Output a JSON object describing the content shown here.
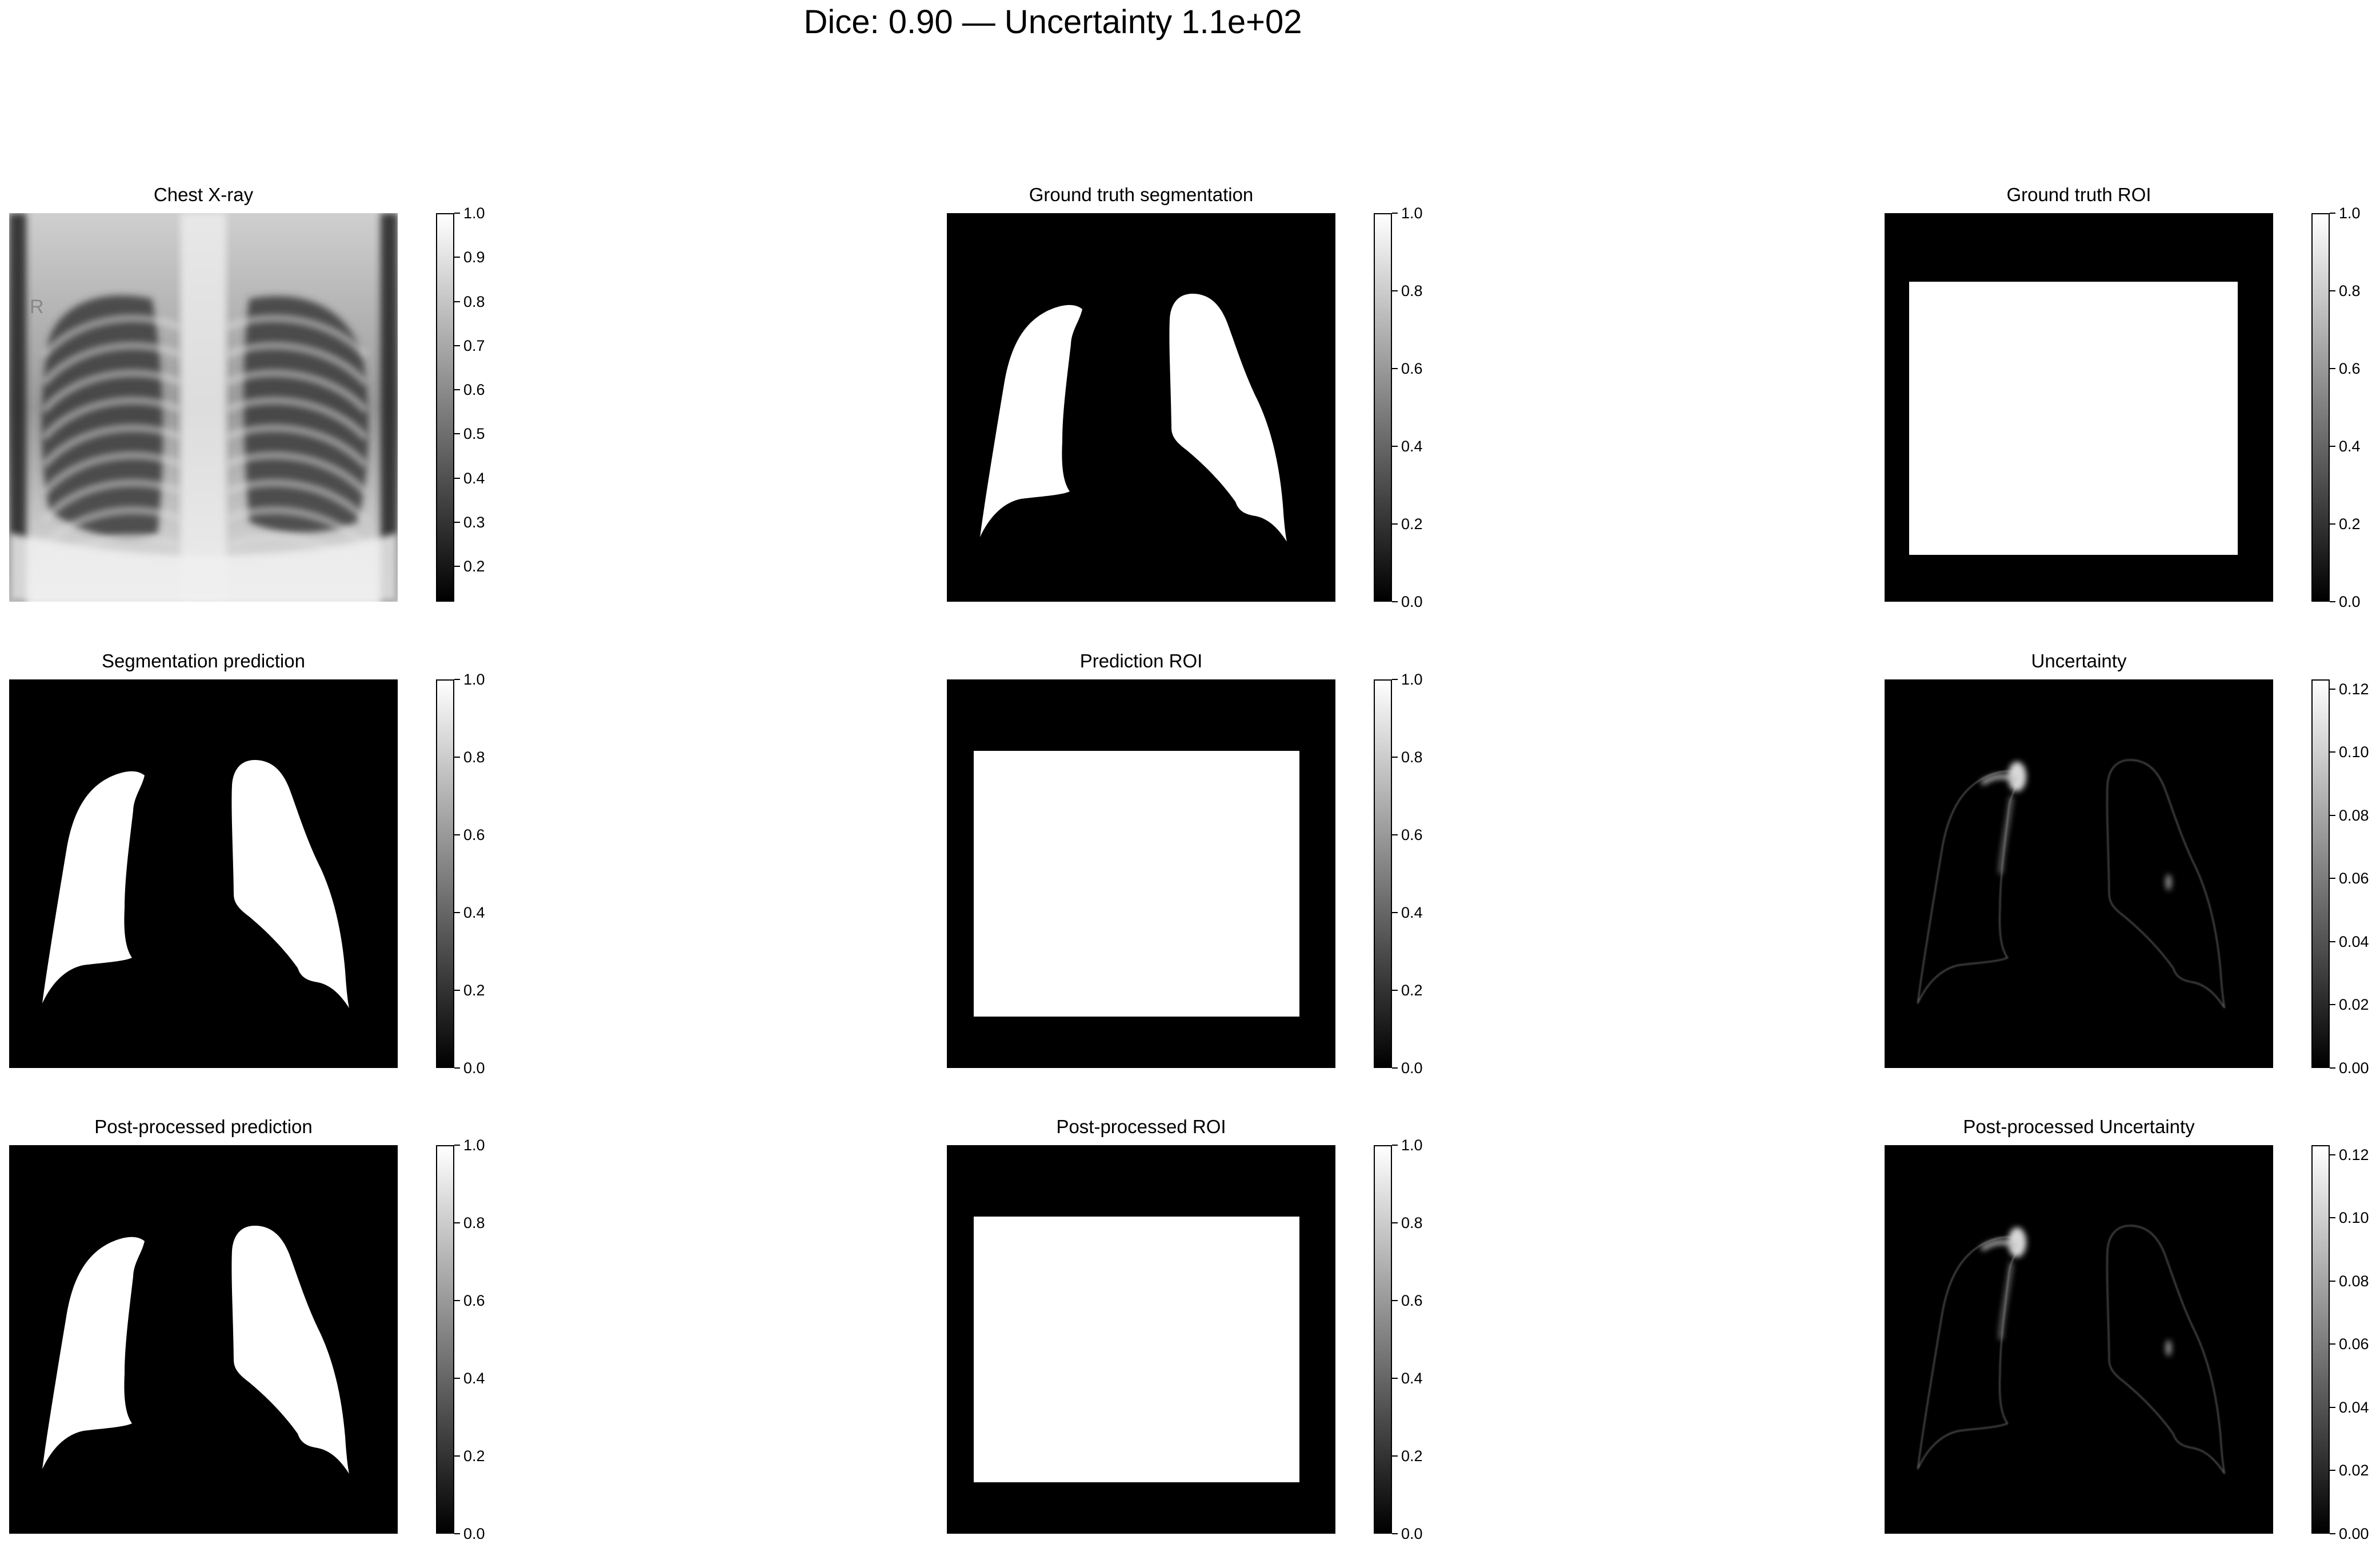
{
  "suptitle": "Dice: 0.90 — Uncertainty 1.1e+02",
  "panels": [
    {
      "title": "Chest X-ray",
      "kind": "xray",
      "colorbar": {
        "ticks": [
          "1.0",
          "0.9",
          "0.8",
          "0.7",
          "0.6",
          "0.5",
          "0.4",
          "0.3",
          "0.2"
        ],
        "vmin": 0.12,
        "vmax": 1.0
      }
    },
    {
      "title": "Ground truth segmentation",
      "kind": "mask-gt",
      "colorbar": {
        "ticks": [
          "1.0",
          "0.8",
          "0.6",
          "0.4",
          "0.2",
          "0.0"
        ],
        "vmin": 0.0,
        "vmax": 1.0
      }
    },
    {
      "title": "Ground truth ROI",
      "kind": "roi-gt",
      "colorbar": {
        "ticks": [
          "1.0",
          "0.8",
          "0.6",
          "0.4",
          "0.2",
          "0.0"
        ],
        "vmin": 0.0,
        "vmax": 1.0
      }
    },
    {
      "title": "Segmentation prediction",
      "kind": "mask-pred",
      "colorbar": {
        "ticks": [
          "1.0",
          "0.8",
          "0.6",
          "0.4",
          "0.2",
          "0.0"
        ],
        "vmin": 0.0,
        "vmax": 1.0
      }
    },
    {
      "title": "Prediction ROI",
      "kind": "roi-pred",
      "colorbar": {
        "ticks": [
          "1.0",
          "0.8",
          "0.6",
          "0.4",
          "0.2",
          "0.0"
        ],
        "vmin": 0.0,
        "vmax": 1.0
      }
    },
    {
      "title": "Uncertainty",
      "kind": "uncertainty",
      "colorbar": {
        "ticks": [
          "0.12",
          "0.10",
          "0.08",
          "0.06",
          "0.04",
          "0.02",
          "0.00"
        ],
        "vmin": 0.0,
        "vmax": 0.123
      }
    },
    {
      "title": "Post-processed prediction",
      "kind": "mask-pred",
      "colorbar": {
        "ticks": [
          "1.0",
          "0.8",
          "0.6",
          "0.4",
          "0.2",
          "0.0"
        ],
        "vmin": 0.0,
        "vmax": 1.0
      }
    },
    {
      "title": "Post-processed ROI",
      "kind": "roi-pred",
      "colorbar": {
        "ticks": [
          "1.0",
          "0.8",
          "0.6",
          "0.4",
          "0.2",
          "0.0"
        ],
        "vmin": 0.0,
        "vmax": 1.0
      }
    },
    {
      "title": "Post-processed Uncertainty",
      "kind": "uncertainty",
      "colorbar": {
        "ticks": [
          "0.12",
          "0.10",
          "0.08",
          "0.06",
          "0.04",
          "0.02",
          "0.00"
        ],
        "vmin": 0.0,
        "vmax": 0.123
      }
    }
  ],
  "xray_marker": "R",
  "colormap": {
    "low": "#000000",
    "high": "#ffffff"
  }
}
